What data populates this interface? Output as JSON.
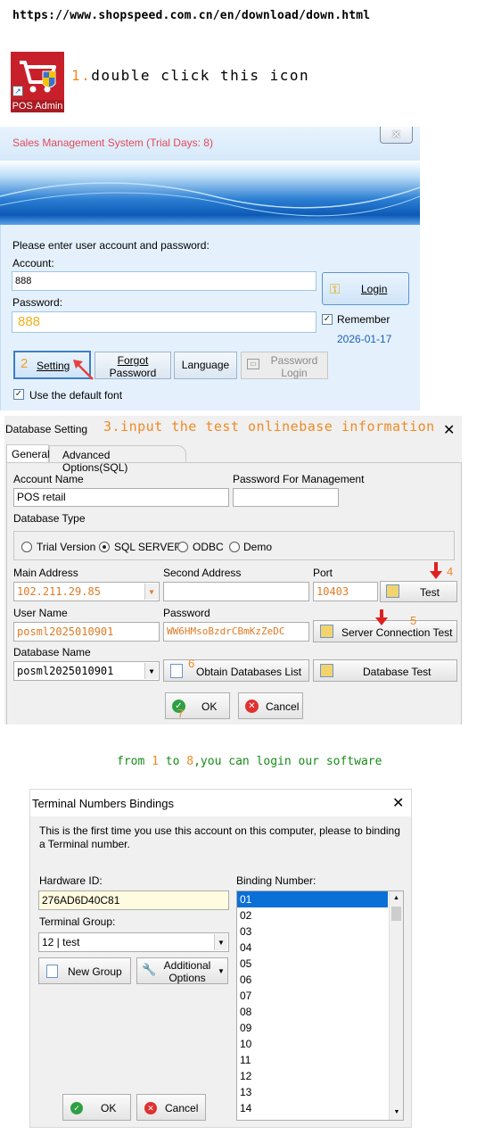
{
  "url": "https://www.shopspeed.com.cn/en/download/down.html",
  "app_icon": {
    "caption": "POS Admin"
  },
  "steps": {
    "s1_num": "1.",
    "s1_text": "double click this icon",
    "s2_num": "2",
    "s3_text": "3.input the test onlinebase information",
    "s4_num": "4",
    "s5_num": "5",
    "s6_num": "6",
    "s7_num": "7",
    "footer_pre": "from ",
    "footer_1": "1",
    "footer_mid": " to ",
    "footer_8": "8",
    "footer_post": ",you can login our software"
  },
  "login": {
    "title": "Sales Management System (Trial Days: 8)",
    "prompt": "Please enter user account and password:",
    "account_label": "Account:",
    "account_value": "888",
    "password_label": "Password:",
    "password_value": "888",
    "login_button": "Login",
    "remember_label": "Remember",
    "remember_checked": true,
    "date": "2026-01-17",
    "setting_button": "Setting",
    "forgot_button_l1": "Forgot",
    "forgot_button_l2": "Password",
    "language_button": "Language",
    "pwlogin_l1": "Password",
    "pwlogin_l2": "Login",
    "default_font_label": "Use the default font",
    "default_font_checked": true
  },
  "db": {
    "title": "Database Setting",
    "tabs": [
      "General",
      "Advanced Options(SQL)"
    ],
    "account_name_label": "Account Name",
    "account_name_value": "POS retail",
    "pw_mgmt_label": "Password For Management",
    "pw_mgmt_value": "",
    "db_type_label": "Database Type",
    "db_types": [
      "Trial Version",
      "SQL SERVER",
      "ODBC",
      "Demo"
    ],
    "db_type_selected": "SQL SERVER",
    "main_addr_label": "Main Address",
    "main_addr_value": "102.211.29.85",
    "second_addr_label": "Second Address",
    "second_addr_value": "",
    "port_label": "Port",
    "port_value": "10403",
    "test_button": "Test",
    "user_label": "User Name",
    "user_value": "posml2025010901",
    "password_label": "Password",
    "password_value": "WW6HMsoBzdrCBmKzZeDC",
    "server_test_button": "Server Connection Test",
    "db_name_label": "Database Name",
    "db_name_value": "posml2025010901",
    "obtain_button": "Obtain Databases List",
    "db_test_button": "Database Test",
    "ok_button": "OK",
    "cancel_button": "Cancel"
  },
  "term": {
    "title": "Terminal Numbers Bindings",
    "message": "This is the first time you use this account on this computer, please to binding a Terminal number.",
    "hw_label": "Hardware ID:",
    "hw_value": "276AD6D40C81",
    "group_label": "Terminal Group:",
    "group_value": "12 | test",
    "new_group_button": "New Group",
    "additional_l1": "Additional",
    "additional_l2": "Options",
    "binding_label": "Binding Number:",
    "binding_numbers": [
      "01",
      "02",
      "03",
      "04",
      "05",
      "06",
      "07",
      "08",
      "09",
      "10",
      "11",
      "12",
      "13",
      "14"
    ],
    "selected": "01",
    "ok_button": "OK",
    "cancel_button": "Cancel"
  },
  "colors": {
    "accent_orange": "#f08a24",
    "title_red": "#e24a5a",
    "footer_green": "#1a8a1a",
    "selection_blue": "#0a6fd6"
  }
}
